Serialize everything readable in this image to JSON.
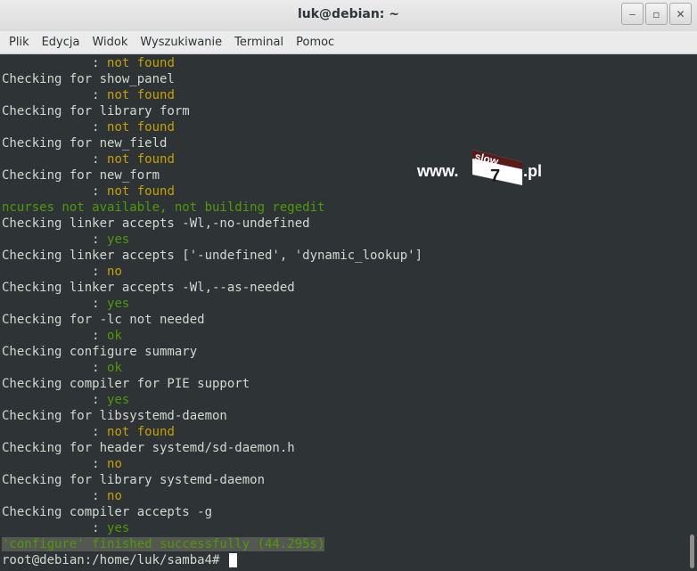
{
  "window": {
    "title": "luk@debian: ~",
    "controls": [
      "minimize",
      "maximize",
      "close"
    ]
  },
  "menu": [
    "Plik",
    "Edycja",
    "Widok",
    "Wyszukiwanie",
    "Terminal",
    "Pomoc"
  ],
  "terminal": {
    "lines": [
      {
        "segments": [
          {
            "text": "            : ",
            "color": "white"
          },
          {
            "text": "not found",
            "color": "yellow"
          }
        ]
      },
      {
        "segments": [
          {
            "text": "Checking for show_panel",
            "color": "white"
          }
        ]
      },
      {
        "segments": [
          {
            "text": "            : ",
            "color": "white"
          },
          {
            "text": "not found",
            "color": "yellow"
          }
        ]
      },
      {
        "segments": [
          {
            "text": "Checking for library form",
            "color": "white"
          }
        ]
      },
      {
        "segments": [
          {
            "text": "            : ",
            "color": "white"
          },
          {
            "text": "not found",
            "color": "yellow"
          }
        ]
      },
      {
        "segments": [
          {
            "text": "Checking for new_field",
            "color": "white"
          }
        ]
      },
      {
        "segments": [
          {
            "text": "            : ",
            "color": "white"
          },
          {
            "text": "not found",
            "color": "yellow"
          }
        ]
      },
      {
        "segments": [
          {
            "text": "Checking for new_form",
            "color": "white"
          }
        ]
      },
      {
        "segments": [
          {
            "text": "            : ",
            "color": "white"
          },
          {
            "text": "not found",
            "color": "yellow"
          }
        ]
      },
      {
        "segments": [
          {
            "text": "ncurses not available, not building regedit",
            "color": "green"
          }
        ]
      },
      {
        "segments": [
          {
            "text": "Checking linker accepts -Wl,-no-undefined",
            "color": "white"
          }
        ]
      },
      {
        "segments": [
          {
            "text": "            : ",
            "color": "white"
          },
          {
            "text": "yes",
            "color": "green"
          }
        ]
      },
      {
        "segments": [
          {
            "text": "Checking linker accepts ['-undefined', 'dynamic_lookup']",
            "color": "white"
          }
        ]
      },
      {
        "segments": [
          {
            "text": "            : ",
            "color": "white"
          },
          {
            "text": "no",
            "color": "yellow"
          }
        ]
      },
      {
        "segments": [
          {
            "text": "Checking linker accepts -Wl,--as-needed",
            "color": "white"
          }
        ]
      },
      {
        "segments": [
          {
            "text": "            : ",
            "color": "white"
          },
          {
            "text": "yes",
            "color": "green"
          }
        ]
      },
      {
        "segments": [
          {
            "text": "Checking for -lc not needed",
            "color": "white"
          }
        ]
      },
      {
        "segments": [
          {
            "text": "            : ",
            "color": "white"
          },
          {
            "text": "ok",
            "color": "green"
          }
        ]
      },
      {
        "segments": [
          {
            "text": "Checking configure summary",
            "color": "white"
          }
        ]
      },
      {
        "segments": [
          {
            "text": "            : ",
            "color": "white"
          },
          {
            "text": "ok",
            "color": "green"
          }
        ]
      },
      {
        "segments": [
          {
            "text": "Checking compiler for PIE support",
            "color": "white"
          }
        ]
      },
      {
        "segments": [
          {
            "text": "            : ",
            "color": "white"
          },
          {
            "text": "yes",
            "color": "green"
          }
        ]
      },
      {
        "segments": [
          {
            "text": "Checking for libsystemd-daemon",
            "color": "white"
          }
        ]
      },
      {
        "segments": [
          {
            "text": "            : ",
            "color": "white"
          },
          {
            "text": "not found",
            "color": "yellow"
          }
        ]
      },
      {
        "segments": [
          {
            "text": "Checking for header systemd/sd-daemon.h",
            "color": "white"
          }
        ]
      },
      {
        "segments": [
          {
            "text": "            : ",
            "color": "white"
          },
          {
            "text": "no",
            "color": "yellow"
          }
        ]
      },
      {
        "segments": [
          {
            "text": "Checking for library systemd-daemon",
            "color": "white"
          }
        ]
      },
      {
        "segments": [
          {
            "text": "            : ",
            "color": "white"
          },
          {
            "text": "no",
            "color": "yellow"
          }
        ]
      },
      {
        "segments": [
          {
            "text": "Checking compiler accepts -g",
            "color": "white"
          }
        ]
      },
      {
        "segments": [
          {
            "text": "            : ",
            "color": "white"
          },
          {
            "text": "yes",
            "color": "green"
          }
        ]
      },
      {
        "segments": [
          {
            "text": "'configure' finished successfully (44.295s)",
            "color": "selected"
          }
        ]
      },
      {
        "segments": [
          {
            "text": "root@debian:/home/luk/samba4# ",
            "color": "white"
          }
        ],
        "cursor": true
      }
    ],
    "colors": {
      "background": "#2e3436",
      "white": "#d3d7cf",
      "yellow": "#c4a000",
      "green": "#4e9a06",
      "selection": "#555753"
    }
  },
  "watermark": {
    "prefix": "www.",
    "badge_top": "slow",
    "badge_number": "7",
    "suffix": ".pl"
  }
}
